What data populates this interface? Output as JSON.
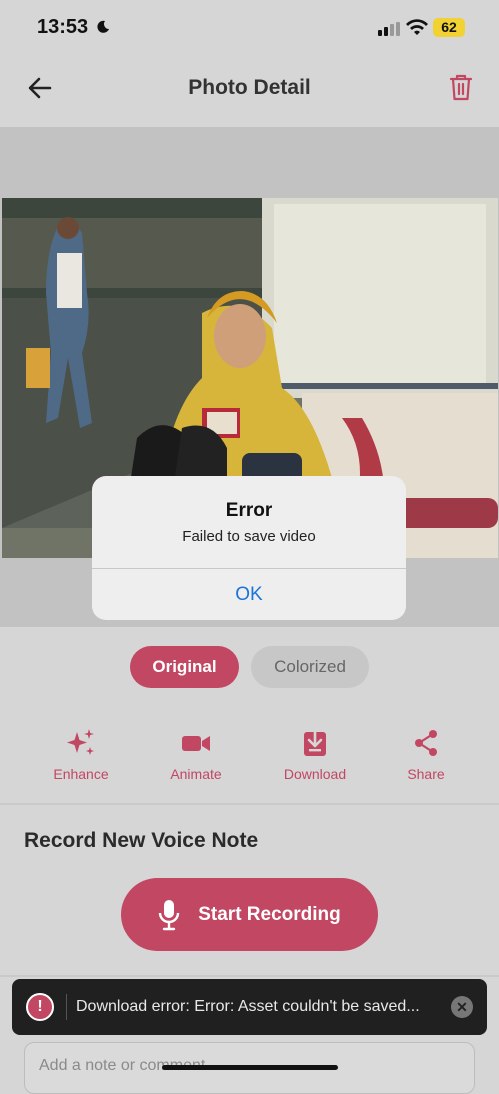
{
  "status_bar": {
    "time": "13:53",
    "battery": "62"
  },
  "header": {
    "title": "Photo Detail"
  },
  "tabs": [
    {
      "label": "Original"
    },
    {
      "label": "Colorized"
    }
  ],
  "actions": [
    {
      "label": "Enhance",
      "icon": "sparkles-icon"
    },
    {
      "label": "Animate",
      "icon": "video-camera-icon"
    },
    {
      "label": "Download",
      "icon": "download-icon"
    },
    {
      "label": "Share",
      "icon": "share-icon"
    }
  ],
  "voice_note": {
    "section_title": "Record New Voice Note",
    "button_label": "Start Recording"
  },
  "note": {
    "placeholder": "Add a note or comment..."
  },
  "toast": {
    "message": "Download error: Error: Asset couldn't be saved..."
  },
  "dialog": {
    "title": "Error",
    "message": "Failed to save video",
    "ok_label": "OK"
  },
  "colors": {
    "accent": "#c24763",
    "link": "#1a74d9"
  }
}
